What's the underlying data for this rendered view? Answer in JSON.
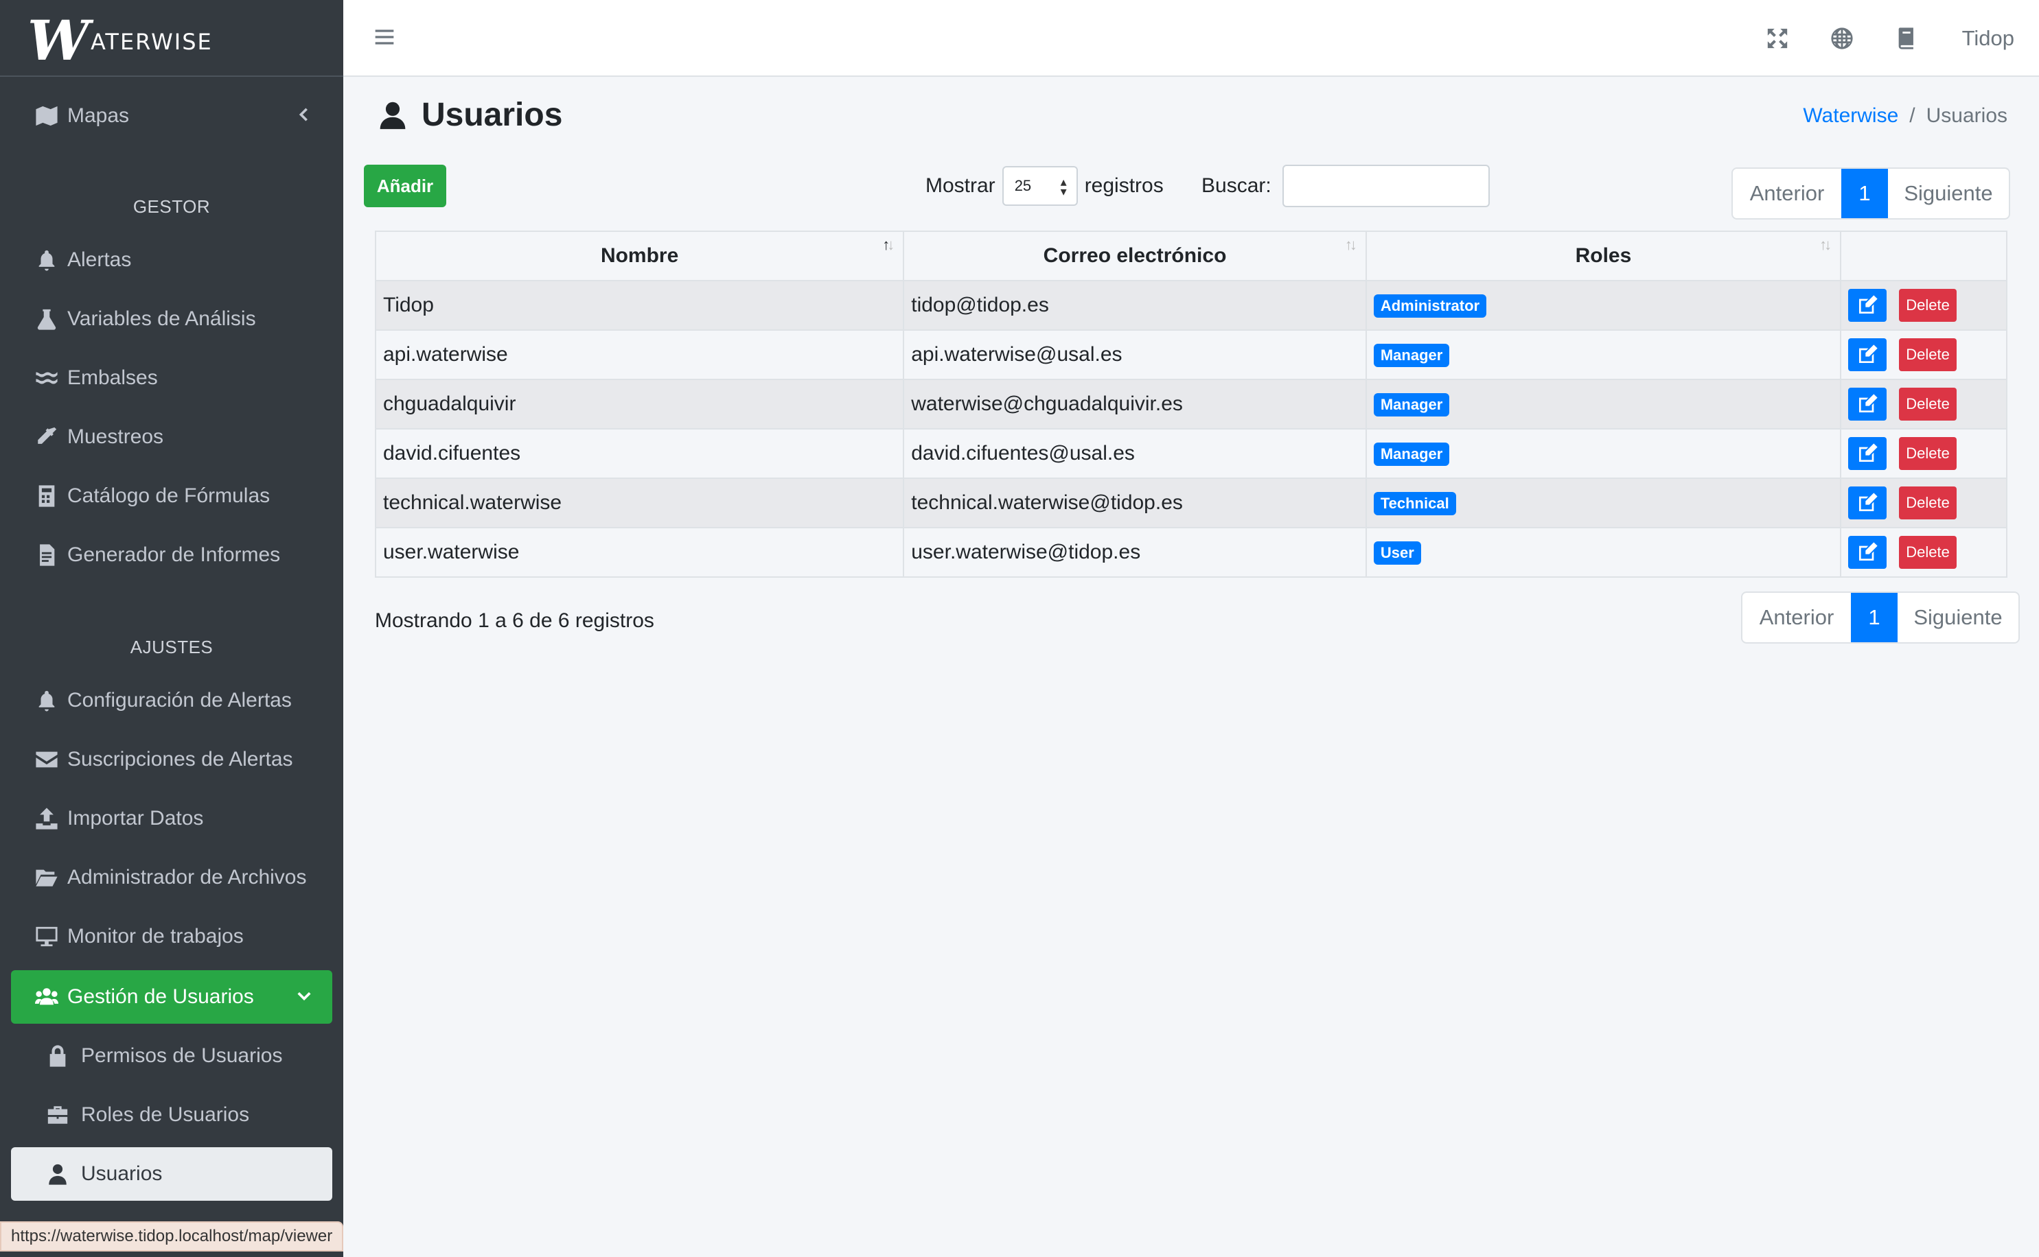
{
  "brand": {
    "logo_letter": "W",
    "logo_text": "ATERWISE"
  },
  "sidebar": {
    "maps_label": "Mapas",
    "section_gestor": "GESTOR",
    "gestor_items": [
      {
        "label": "Alertas",
        "icon": "bell-icon"
      },
      {
        "label": "Variables de Análisis",
        "icon": "flask-icon"
      },
      {
        "label": "Embalses",
        "icon": "water-icon"
      },
      {
        "label": "Muestreos",
        "icon": "eyedropper-icon"
      },
      {
        "label": "Catálogo de Fórmulas",
        "icon": "calculator-icon"
      },
      {
        "label": "Generador de Informes",
        "icon": "file-icon"
      }
    ],
    "section_ajustes": "AJUSTES",
    "ajustes_items": [
      {
        "label": "Configuración de Alertas",
        "icon": "bell-icon"
      },
      {
        "label": "Suscripciones de Alertas",
        "icon": "envelope-icon"
      },
      {
        "label": "Importar Datos",
        "icon": "upload-icon"
      },
      {
        "label": "Administrador de Archivos",
        "icon": "folder-open-icon"
      },
      {
        "label": "Monitor de trabajos",
        "icon": "desktop-icon"
      }
    ],
    "users_group_label": "Gestión de Usuarios",
    "users_sub": [
      {
        "label": "Permisos de Usuarios",
        "icon": "lock-icon"
      },
      {
        "label": "Roles de Usuarios",
        "icon": "briefcase-icon"
      },
      {
        "label": "Usuarios",
        "icon": "user-icon"
      }
    ]
  },
  "topbar": {
    "user": "Tidop"
  },
  "page": {
    "title": "Usuarios",
    "breadcrumb": {
      "home": "Waterwise",
      "sep": "/",
      "current": "Usuarios"
    }
  },
  "controls": {
    "add_label": "Añadir",
    "show_label": "Mostrar",
    "show_value": "25",
    "records_label": "registros",
    "search_label": "Buscar:",
    "search_value": ""
  },
  "pagination": {
    "prev": "Anterior",
    "page": "1",
    "next": "Siguiente"
  },
  "table": {
    "headers": [
      "Nombre",
      "Correo electrónico",
      "Roles",
      ""
    ],
    "rows": [
      {
        "name": "Tidop",
        "email": "tidop@tidop.es",
        "role": "Administrator"
      },
      {
        "name": "api.waterwise",
        "email": "api.waterwise@usal.es",
        "role": "Manager"
      },
      {
        "name": "chguadalquivir",
        "email": "waterwise@chguadalquivir.es",
        "role": "Manager"
      },
      {
        "name": "david.cifuentes",
        "email": "david.cifuentes@usal.es",
        "role": "Manager"
      },
      {
        "name": "technical.waterwise",
        "email": "technical.waterwise@tidop.es",
        "role": "Technical"
      },
      {
        "name": "user.waterwise",
        "email": "user.waterwise@tidop.es",
        "role": "User"
      }
    ],
    "delete_label": "Delete"
  },
  "info_text": "Mostrando 1 a 6 de 6 registros",
  "status_url": "https://waterwise.tidop.localhost/map/viewer",
  "colors": {
    "primary": "#007bff",
    "success": "#28a745",
    "danger": "#dc3545",
    "sidebar": "#343a40"
  }
}
